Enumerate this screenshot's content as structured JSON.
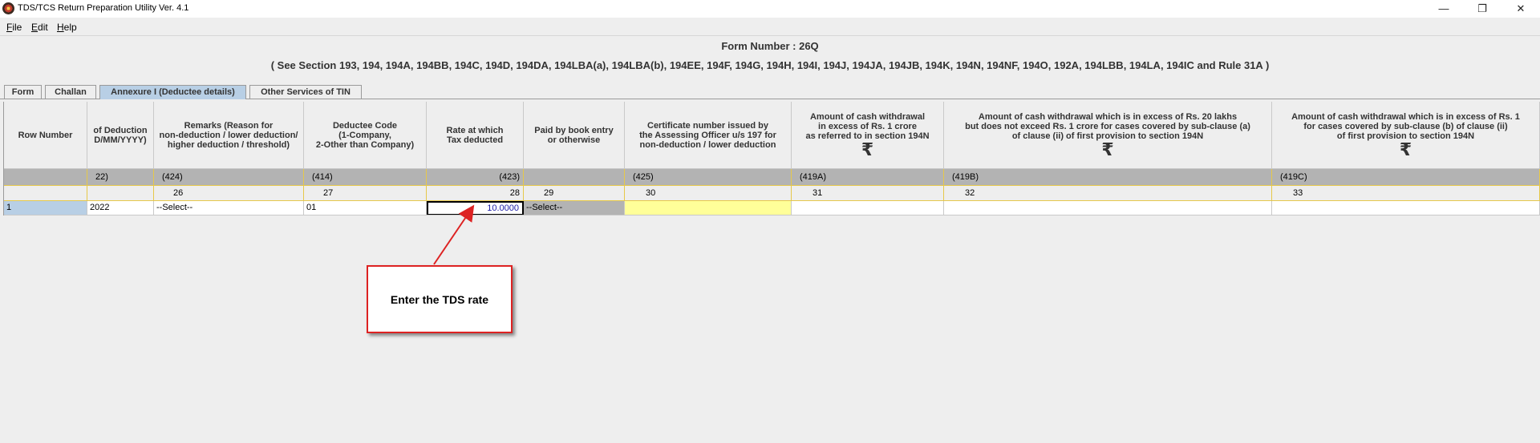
{
  "window": {
    "title": "TDS/TCS Return Preparation Utility Ver. 4.1",
    "minimize": "—",
    "maximize": "❐",
    "close": "✕"
  },
  "menu": [
    "File",
    "Edit",
    "Help"
  ],
  "header": {
    "form_number": "Form Number : 26Q",
    "sections": "( See Section 193, 194, 194A, 194BB, 194C, 194D, 194DA, 194LBA(a), 194LBA(b), 194EE, 194F, 194G, 194H, 194I, 194J, 194JA, 194JB, 194K, 194N, 194NF, 194O, 192A, 194LBB, 194LA, 194IC and Rule 31A )"
  },
  "tabs": [
    {
      "label": "Form",
      "active": false
    },
    {
      "label": "Challan",
      "active": false
    },
    {
      "label": "Annexure I (Deductee details)",
      "active": true
    },
    {
      "label": "Other Services of TIN",
      "active": false
    }
  ],
  "grid": {
    "columns": [
      {
        "header": [
          "Row Number"
        ],
        "code": "",
        "num": "",
        "value": "1",
        "rupee": ""
      },
      {
        "header": [
          "of Deduction",
          "D/MM/YYYY)"
        ],
        "code": "22)",
        "num": "",
        "value": "2022",
        "rupee": ""
      },
      {
        "header": [
          "Remarks (Reason for",
          "non-deduction / lower deduction/",
          "higher deduction / threshold)"
        ],
        "code": "(424)",
        "num": "26",
        "value": "--Select--",
        "rupee": ""
      },
      {
        "header": [
          "Deductee Code",
          "(1-Company,",
          "2-Other than Company)"
        ],
        "code": "(414)",
        "num": "27",
        "value": "01",
        "rupee": ""
      },
      {
        "header": [
          "Rate at which",
          "Tax deducted"
        ],
        "code": "(423)",
        "num": "28",
        "value": "10.0000",
        "rupee": ""
      },
      {
        "header": [
          "Paid by book entry",
          "or otherwise"
        ],
        "code": "",
        "num": "29",
        "value": "--Select--",
        "rupee": ""
      },
      {
        "header": [
          "Certificate number issued by",
          "the Assessing Officer u/s 197 for",
          "non-deduction / lower deduction"
        ],
        "code": "(425)",
        "num": "30",
        "value": "",
        "rupee": ""
      },
      {
        "header": [
          "Amount of cash withdrawal",
          "in excess of Rs. 1 crore",
          "as referred to in section 194N"
        ],
        "code": "(419A)",
        "num": "31",
        "value": "",
        "rupee": "₹"
      },
      {
        "header": [
          "Amount of cash withdrawal which is in excess of Rs. 20 lakhs",
          "but does not exceed Rs. 1 crore for cases covered by sub-clause (a)",
          "of clause (ii) of first provision to section 194N"
        ],
        "code": "(419B)",
        "num": "32",
        "value": "",
        "rupee": "₹"
      },
      {
        "header": [
          "Amount of cash withdrawal which is in excess of Rs. 1",
          "for cases covered by sub-clause (b) of clause (ii)",
          "of first provision to section 194N"
        ],
        "code": "(419C)",
        "num": "33",
        "value": "",
        "rupee": "₹"
      }
    ]
  },
  "callout": {
    "text": "Enter the TDS rate"
  },
  "colors": {
    "active_tab": "#b8cfe5",
    "selected_cell": "#ffff99",
    "code_row": "#b3b3b3",
    "callout_border": "#dd2222",
    "rate_text": "#1a1aa6"
  }
}
